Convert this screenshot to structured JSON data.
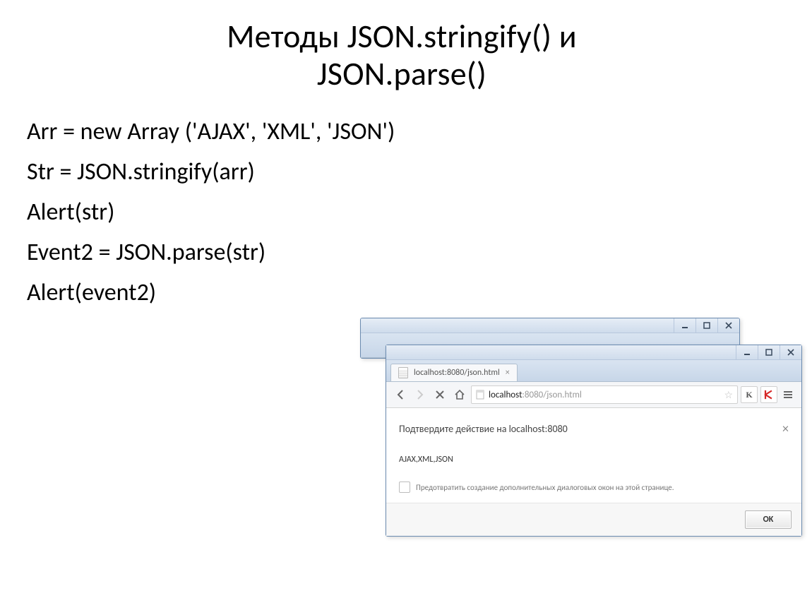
{
  "title_line1": "Методы JSON.stringify() и",
  "title_line2": "JSON.parse()",
  "code": {
    "l1": "Arr = new Array ('AJAX', 'XML', 'JSON')",
    "l2": "Str = JSON.stringify(arr)",
    "l3": "Alert(str)",
    "l4": "Event2 = JSON.parse(str)",
    "l5": "Alert(event2)"
  },
  "browser": {
    "tab_label": "localhost:8080/json.html",
    "url_host": "localhost",
    "url_port_path": ":8080/json.html",
    "ext_k_label": "K"
  },
  "dialog": {
    "title": "Подтвердите действие на localhost:8080",
    "message": "AJAX,XML,JSON",
    "checkbox_label": "Предотвратить создание дополнительных диалоговых окон на этой странице.",
    "ok_label": "OK"
  }
}
